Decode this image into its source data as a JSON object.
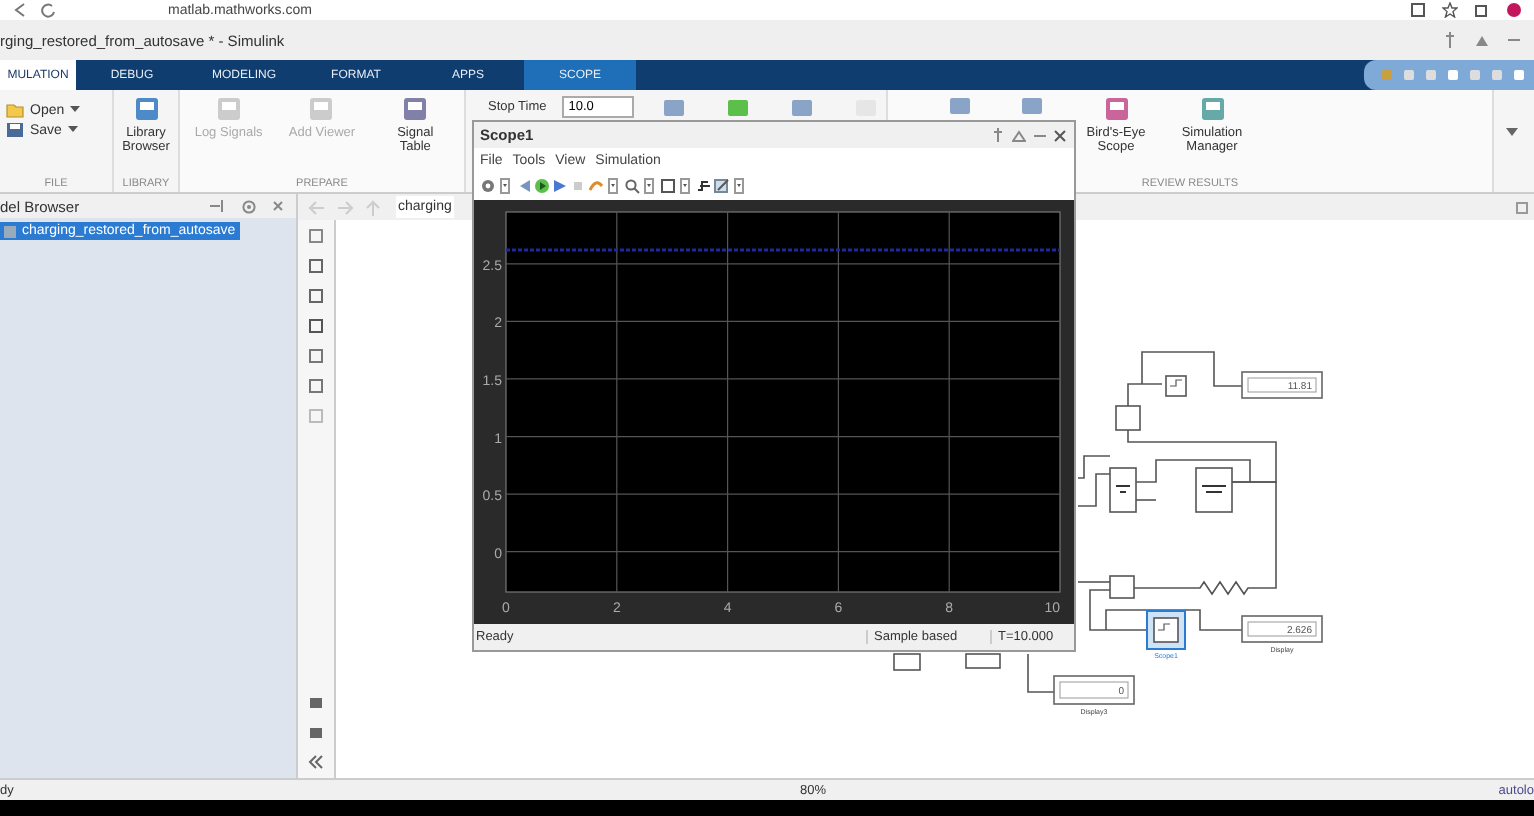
{
  "browser": {
    "url": "matlab.mathworks.com"
  },
  "window": {
    "title": "rging_restored_from_autosave * - Simulink"
  },
  "tabs": [
    {
      "label": "MULATION",
      "selected": true,
      "kind": "main"
    },
    {
      "label": "DEBUG",
      "selected": false,
      "kind": "main"
    },
    {
      "label": "MODELING",
      "selected": false,
      "kind": "main"
    },
    {
      "label": "FORMAT",
      "selected": false,
      "kind": "main"
    },
    {
      "label": "APPS",
      "selected": false,
      "kind": "main"
    },
    {
      "label": "SCOPE",
      "selected": false,
      "kind": "contextual"
    }
  ],
  "ribbon": {
    "groups": [
      {
        "label": "FILE",
        "items": [
          {
            "kind": "small",
            "label": "Open",
            "disabled": false
          },
          {
            "kind": "small",
            "label": "Save",
            "disabled": false
          }
        ]
      },
      {
        "label": "LIBRARY",
        "items": [
          {
            "kind": "large",
            "label": "Library Browser",
            "disabled": false
          }
        ]
      },
      {
        "label": "PREPARE",
        "items": [
          {
            "kind": "large",
            "label": "Log Signals",
            "disabled": true
          },
          {
            "kind": "large",
            "label": "Add Viewer",
            "disabled": true
          },
          {
            "kind": "large",
            "label": "Signal Table",
            "disabled": false
          }
        ]
      },
      {
        "items": [
          {
            "kind": "field",
            "label": "Stop Time",
            "value": "10.0"
          },
          {
            "kind": "icon",
            "disabled": false
          },
          {
            "kind": "icon",
            "disabled": false
          },
          {
            "kind": "icon",
            "disabled": false
          },
          {
            "kind": "icon",
            "disabled": true
          }
        ]
      },
      {
        "label": "REVIEW RESULTS",
        "items": [
          {
            "kind": "icon",
            "disabled": false
          },
          {
            "kind": "icon",
            "disabled": false
          },
          {
            "kind": "large",
            "label": "Bird's-Eye Scope",
            "disabled": false
          },
          {
            "kind": "large",
            "label": "Simulation Manager",
            "disabled": false
          }
        ]
      }
    ]
  },
  "model_browser": {
    "title": "del Browser",
    "items": [
      {
        "label": "charging_restored_from_autosave",
        "selected": true
      }
    ]
  },
  "editor": {
    "breadcrumb": "charging",
    "blocks": [
      {
        "kind": "scope",
        "selected": false
      },
      {
        "kind": "display",
        "value": "11.81"
      },
      {
        "kind": "operator"
      },
      {
        "kind": "battery"
      },
      {
        "kind": "battery"
      },
      {
        "kind": "operator"
      },
      {
        "kind": "resistor"
      },
      {
        "kind": "scope",
        "selected": true,
        "label": "Scope1"
      },
      {
        "kind": "display",
        "value": "2.626",
        "label": "Display"
      },
      {
        "kind": "display",
        "value": "0",
        "label": "Display3"
      },
      {
        "kind": "operator"
      },
      {
        "kind": "operator"
      }
    ]
  },
  "scope_window": {
    "title": "Scope1",
    "menu": [
      "File",
      "Tools",
      "View",
      "Simulation"
    ],
    "status": "Ready",
    "mode": "Sample based",
    "time": "T=10.000",
    "chart_data": {
      "type": "line",
      "x": [
        0,
        10
      ],
      "series": [
        {
          "color": "#1c2a9c",
          "line_style": "dashed",
          "values": [
            2.62,
            2.62
          ]
        }
      ],
      "grid": true,
      "xlim": [
        0,
        10
      ],
      "ylim": [
        -0.35,
        2.95
      ],
      "xticks": [
        0,
        2,
        4,
        6,
        8,
        10
      ],
      "yticks": [
        0,
        0.5,
        1,
        1.5,
        2,
        2.5
      ]
    }
  },
  "status_bar": {
    "left": "dy",
    "zoom": "80%",
    "right": "autolo"
  }
}
